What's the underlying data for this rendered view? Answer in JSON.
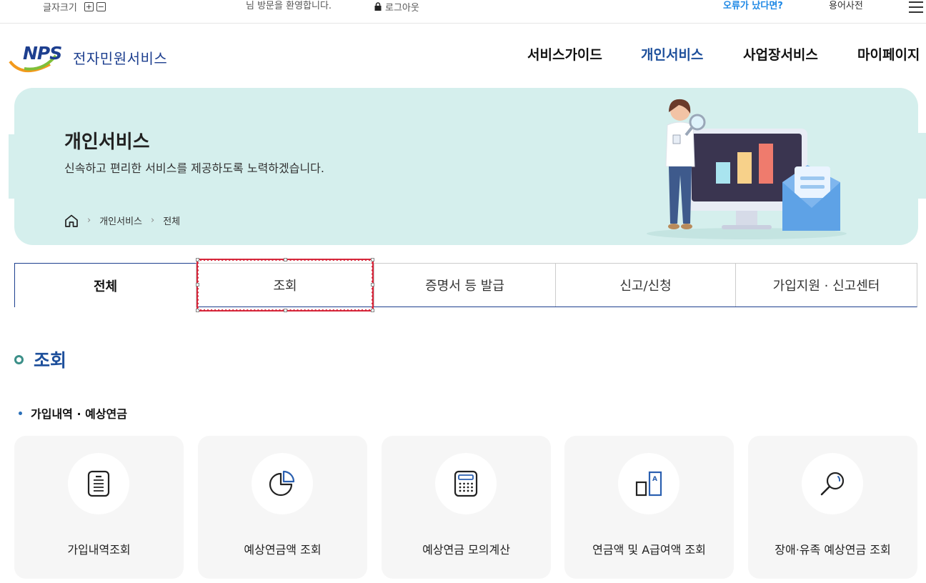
{
  "util": {
    "font_size_label": "글자크기",
    "font_plus": "+",
    "font_minus": "−",
    "welcome": "님 방문을 환영합니다.",
    "logout": "로그아웃",
    "error_report": "오류가 났다면?",
    "dictionary": "용어사전"
  },
  "header": {
    "logo_text": "NPS",
    "site_name": "전자민원서비스",
    "nav": [
      "서비스가이드",
      "개인서비스",
      "사업장서비스",
      "마이페이지"
    ],
    "active_nav": "개인서비스"
  },
  "hero": {
    "title": "개인서비스",
    "subtitle": "신속하고 편리한 서비스를 제공하도록 노력하겠습니다.",
    "breadcrumb": [
      "개인서비스",
      "전체"
    ]
  },
  "tabs": [
    "전체",
    "조회",
    "증명서 등 발급",
    "신고/신청",
    "가입지원 · 신고센터"
  ],
  "active_tab": "전체",
  "section": {
    "title": "조회",
    "subsection": "가입내역 · 예상연금"
  },
  "cards": [
    {
      "label": "가입내역조회",
      "icon": "document-list-icon"
    },
    {
      "label": "예상연금액 조회",
      "icon": "pie-chart-icon"
    },
    {
      "label": "예상연금 모의계산",
      "icon": "calculator-icon"
    },
    {
      "label": "연금액 및 A급여액 조회",
      "icon": "compare-a-icon"
    },
    {
      "label": "장애·유족 예상연금 조회",
      "icon": "magnifier-icon"
    }
  ],
  "colors": {
    "brand_navy": "#1d3f8f",
    "nav_active": "#1d4f9b",
    "hero_bg": "#d5efed",
    "error_link": "#1e88e5",
    "selection_red": "#d6283c"
  }
}
